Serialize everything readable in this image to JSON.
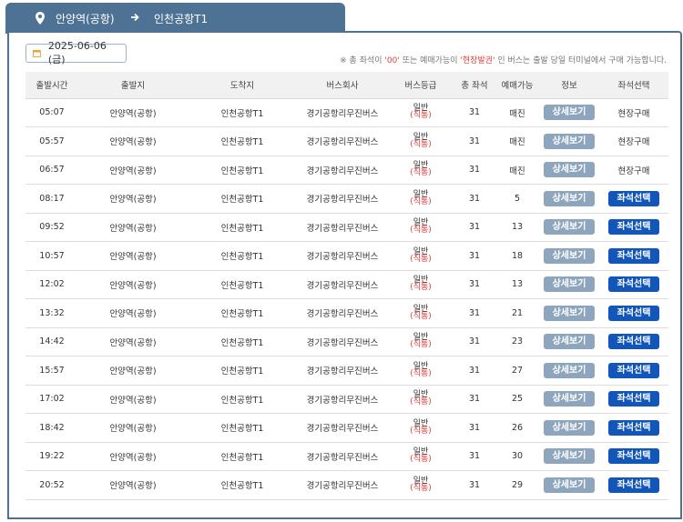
{
  "route": {
    "from": "안양역(공항)",
    "to": "인천공항T1"
  },
  "date": {
    "value": "2025-06-06 (금)"
  },
  "notice": {
    "prefix": "※ 총 좌석이",
    "zero": "'00'",
    "middle": "또는 예매가능이",
    "onsite_term": "'현장발권'",
    "suffix": "인 버스는 출발 당일 터미널에서 구매 가능합니다."
  },
  "table": {
    "headers": [
      "출발시간",
      "출발지",
      "도착지",
      "버스회사",
      "버스등급",
      "총 좌석",
      "예매가능",
      "정보",
      "좌석선택"
    ],
    "detail_label": "상세보기",
    "seat_label": "좌석선택",
    "onsite_label": "현장구매",
    "rows": [
      {
        "time": "05:07",
        "from": "안양역(공항)",
        "to": "인천공항T1",
        "company": "경기공항리무진버스",
        "grade1": "일반",
        "grade2": "(직통)",
        "total": "31",
        "avail": "매진",
        "onsite": true
      },
      {
        "time": "05:57",
        "from": "안양역(공항)",
        "to": "인천공항T1",
        "company": "경기공항리무진버스",
        "grade1": "일반",
        "grade2": "(직통)",
        "total": "31",
        "avail": "매진",
        "onsite": true
      },
      {
        "time": "06:57",
        "from": "안양역(공항)",
        "to": "인천공항T1",
        "company": "경기공항리무진버스",
        "grade1": "일반",
        "grade2": "(직통)",
        "total": "31",
        "avail": "매진",
        "onsite": true
      },
      {
        "time": "08:17",
        "from": "안양역(공항)",
        "to": "인천공항T1",
        "company": "경기공항리무진버스",
        "grade1": "일반",
        "grade2": "(직통)",
        "total": "31",
        "avail": "5",
        "onsite": false
      },
      {
        "time": "09:52",
        "from": "안양역(공항)",
        "to": "인천공항T1",
        "company": "경기공항리무진버스",
        "grade1": "일반",
        "grade2": "(직통)",
        "total": "31",
        "avail": "13",
        "onsite": false
      },
      {
        "time": "10:57",
        "from": "안양역(공항)",
        "to": "인천공항T1",
        "company": "경기공항리무진버스",
        "grade1": "일반",
        "grade2": "(직통)",
        "total": "31",
        "avail": "18",
        "onsite": false
      },
      {
        "time": "12:02",
        "from": "안양역(공항)",
        "to": "인천공항T1",
        "company": "경기공항리무진버스",
        "grade1": "일반",
        "grade2": "(직통)",
        "total": "31",
        "avail": "13",
        "onsite": false
      },
      {
        "time": "13:32",
        "from": "안양역(공항)",
        "to": "인천공항T1",
        "company": "경기공항리무진버스",
        "grade1": "일반",
        "grade2": "(직통)",
        "total": "31",
        "avail": "21",
        "onsite": false
      },
      {
        "time": "14:42",
        "from": "안양역(공항)",
        "to": "인천공항T1",
        "company": "경기공항리무진버스",
        "grade1": "일반",
        "grade2": "(직통)",
        "total": "31",
        "avail": "23",
        "onsite": false
      },
      {
        "time": "15:57",
        "from": "안양역(공항)",
        "to": "인천공항T1",
        "company": "경기공항리무진버스",
        "grade1": "일반",
        "grade2": "(직통)",
        "total": "31",
        "avail": "27",
        "onsite": false
      },
      {
        "time": "17:02",
        "from": "안양역(공항)",
        "to": "인천공항T1",
        "company": "경기공항리무진버스",
        "grade1": "일반",
        "grade2": "(직통)",
        "total": "31",
        "avail": "25",
        "onsite": false
      },
      {
        "time": "18:42",
        "from": "안양역(공항)",
        "to": "인천공항T1",
        "company": "경기공항리무진버스",
        "grade1": "일반",
        "grade2": "(직통)",
        "total": "31",
        "avail": "26",
        "onsite": false
      },
      {
        "time": "19:22",
        "from": "안양역(공항)",
        "to": "인천공항T1",
        "company": "경기공항리무진버스",
        "grade1": "일반",
        "grade2": "(직통)",
        "total": "31",
        "avail": "30",
        "onsite": false
      },
      {
        "time": "20:52",
        "from": "안양역(공항)",
        "to": "인천공항T1",
        "company": "경기공항리무진버스",
        "grade1": "일반",
        "grade2": "(직통)",
        "total": "31",
        "avail": "29",
        "onsite": false
      }
    ]
  },
  "colors": {
    "tab": "#4d7294",
    "detail_button": "#8ea6bd",
    "seat_button": "#1156b8",
    "highlight_red": "#e33b3b"
  },
  "icons": {
    "tab_left": "location-pin-icon",
    "tab_mid": "arrow-right-icon",
    "date": "calendar-icon"
  }
}
